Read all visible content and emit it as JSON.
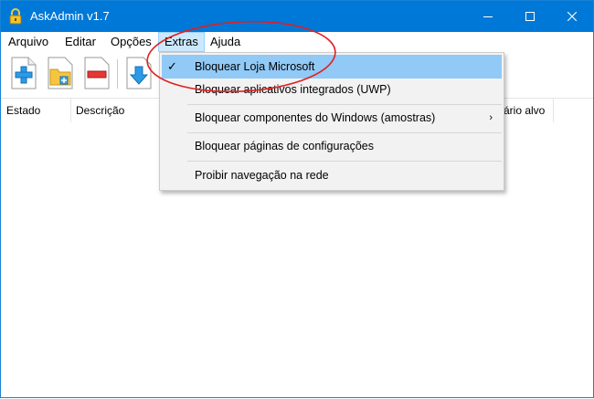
{
  "window": {
    "title": "AskAdmin v1.7",
    "accent": "#0078d7"
  },
  "menubar": {
    "items": [
      "Arquivo",
      "Editar",
      "Opções",
      "Extras",
      "Ajuda"
    ],
    "active": "Extras"
  },
  "toolbar": {
    "buttons": [
      "add-file-icon",
      "add-folder-icon",
      "remove-icon",
      "import-icon"
    ]
  },
  "list": {
    "columns": [
      "Estado",
      "Descrição",
      "ário alvo"
    ]
  },
  "extras_menu": {
    "items": [
      {
        "label": "Bloquear Loja Microsoft",
        "checked": true
      },
      {
        "label": "Bloquear aplicativos integrados (UWP)"
      },
      {
        "label": "Bloquear componentes do Windows (amostras)",
        "submenu": true
      },
      {
        "label": "Bloquear páginas de configurações"
      },
      {
        "label": "Proibir navegação na rede"
      }
    ],
    "highlight_color": "#91c9f7"
  },
  "annotation": {
    "color": "#e02020"
  }
}
